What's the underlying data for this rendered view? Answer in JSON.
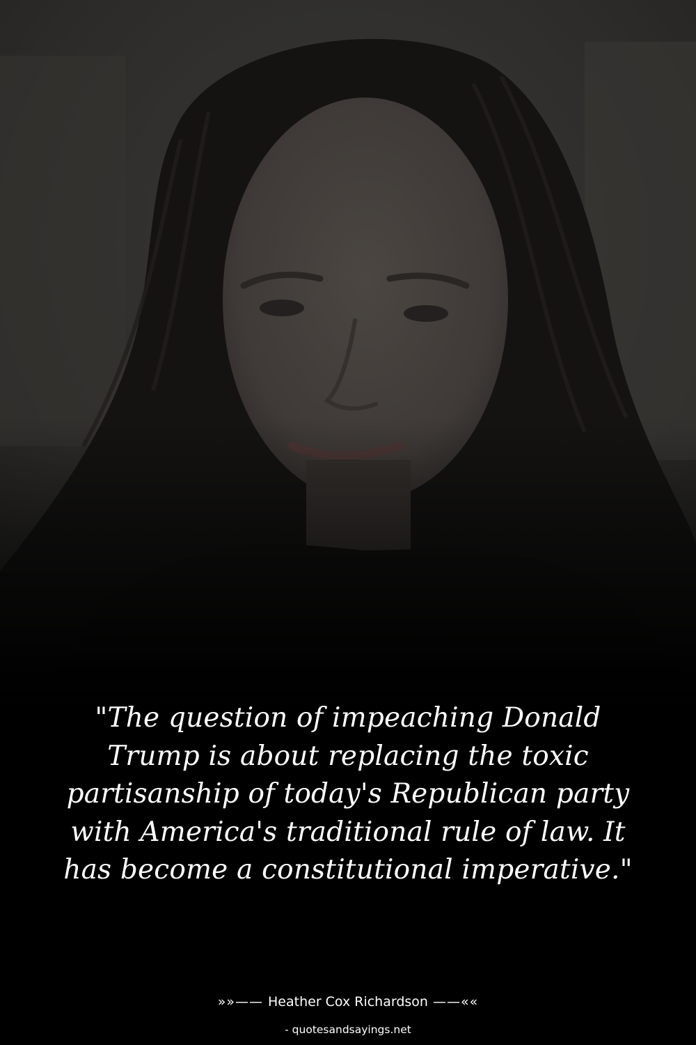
{
  "quote": {
    "text": "\"The question of impeaching Donald Trump is about replacing the toxic partisanship of today's Republican party with America's traditional rule of law. It has become a constitutional imperative.\""
  },
  "author": {
    "prefix": "»»—— ",
    "name": "Heather Cox Richardson",
    "suffix": " ——««"
  },
  "site": {
    "label": "- quotesandsayings.net"
  },
  "photo": {
    "subject": "portrait of Heather Cox Richardson"
  },
  "colors": {
    "background": "#000000",
    "text": "#ffffff"
  }
}
